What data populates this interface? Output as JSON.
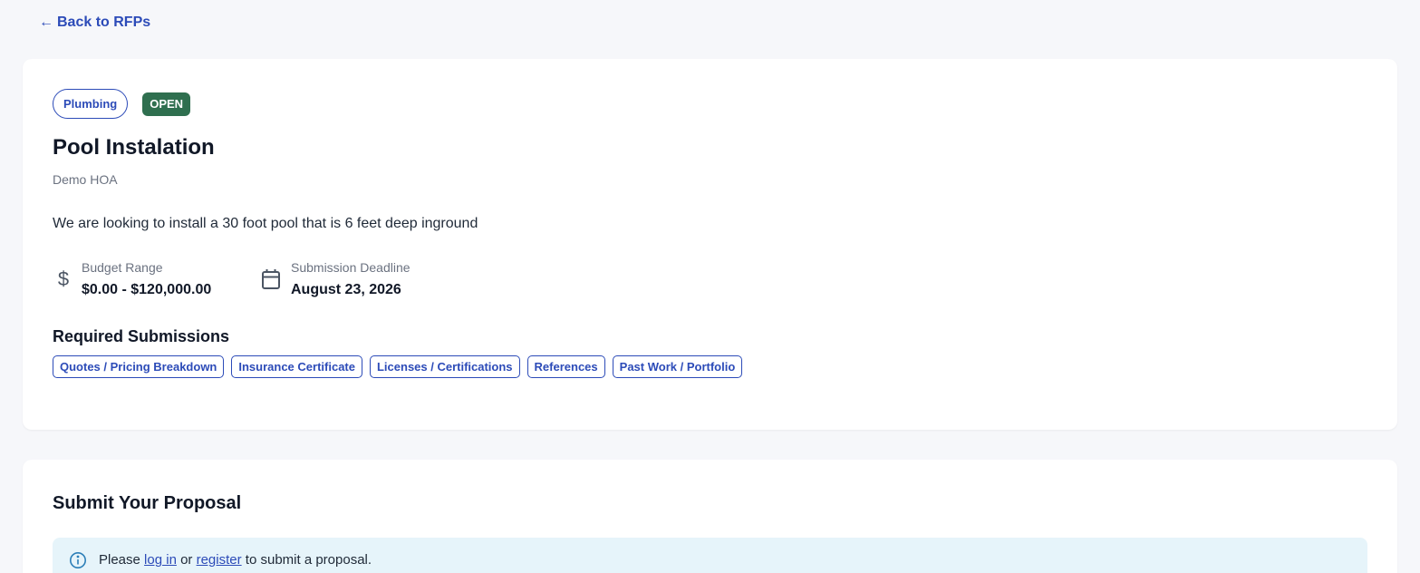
{
  "nav": {
    "back_arrow": "←",
    "back_label": "Back to RFPs"
  },
  "rfp": {
    "category": "Plumbing",
    "status": "OPEN",
    "title": "Pool Instalation",
    "organization": "Demo HOA",
    "description": "We are looking to install a 30 foot pool that is 6 feet deep inground",
    "budget": {
      "icon": "dollar-icon",
      "label": "Budget Range",
      "value": "$0.00 - $120,000.00"
    },
    "deadline": {
      "icon": "calendar-icon",
      "label": "Submission Deadline",
      "value": "August 23, 2026"
    },
    "required_heading": "Required Submissions",
    "required_items": [
      "Quotes / Pricing Breakdown",
      "Insurance Certificate",
      "Licenses / Certifications",
      "References",
      "Past Work / Portfolio"
    ]
  },
  "proposal": {
    "heading": "Submit Your Proposal",
    "notice": {
      "icon": "info-icon",
      "prefix": "Please",
      "login_link": "log in",
      "middle": "or",
      "register_link": "register",
      "suffix": "to submit a proposal."
    }
  },
  "colors": {
    "accent": "#2c4bb8",
    "status_open": "#2f6f4f",
    "background": "#f6f7fa",
    "notice_bg": "#e6f4fa"
  }
}
